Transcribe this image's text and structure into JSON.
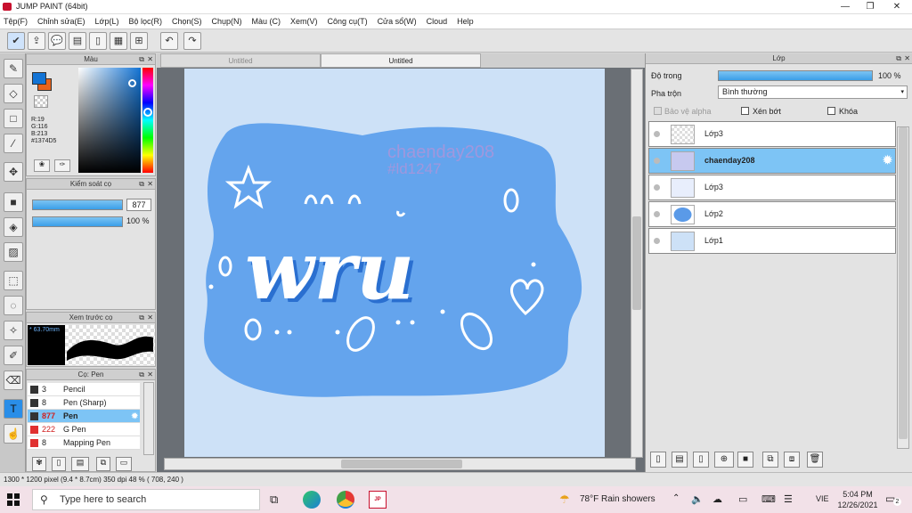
{
  "window": {
    "title": "JUMP PAINT (64bit)",
    "controls": [
      "—",
      "❐",
      "✕"
    ]
  },
  "menu": [
    "Tệp(F)",
    "Chỉnh sửa(E)",
    "Lớp(L)",
    "Bộ lọc(R)",
    "Chọn(S)",
    "Chụp(N)",
    "Màu (C)",
    "Xem(V)",
    "Công cụ(T)",
    "Cửa sổ(W)",
    "Cloud",
    "Help"
  ],
  "color_panel": {
    "title": "Màu",
    "r": "R:19",
    "g": "G:116",
    "b": "B:213",
    "hex": "#1374D5",
    "primary": "#1374d5",
    "secondary": "#e8631c"
  },
  "brush_control": {
    "title": "Kiểm soát cọ",
    "size": "877",
    "opacity": "100 %"
  },
  "preview": {
    "title": "Xem trước cọ",
    "size_label": "* 63.70mm"
  },
  "brush_list": {
    "title": "Cọ: Pen",
    "items": [
      {
        "num": "3",
        "name": "Pencil",
        "color": "#333333"
      },
      {
        "num": "8",
        "name": "Pen (Sharp)",
        "color": "#333333"
      },
      {
        "num": "877",
        "name": "Pen",
        "color": "#333333",
        "selected": true
      },
      {
        "num": "222",
        "name": "G Pen",
        "color": "#e03030"
      },
      {
        "num": "8",
        "name": "Mapping Pen",
        "color": "#e03030"
      }
    ]
  },
  "tabs": [
    "Untitled",
    "Untitled"
  ],
  "canvas": {
    "watermark1": "chaenday208",
    "watermark2": "#ld1247",
    "art_text": "wru"
  },
  "layer_panel": {
    "title": "Lớp",
    "opacity_label": "Độ trong",
    "opacity_value": "100 %",
    "blend_label": "Pha trộn",
    "blend_value": "Bình thường",
    "protect_alpha": "Bảo vệ alpha",
    "clip": "Xén bớt",
    "lock": "Khóa",
    "layers": [
      {
        "name": "Lớp3",
        "selected": false
      },
      {
        "name": "chaenday208",
        "selected": true
      },
      {
        "name": "Lớp3",
        "selected": false
      },
      {
        "name": "Lớp2",
        "selected": false
      },
      {
        "name": "Lớp1",
        "selected": false
      }
    ]
  },
  "status": {
    "text": "1300 * 1200 pixel  (9.4 * 8.7cm)  350 dpi  48 %  ( 708, 240 )"
  },
  "taskbar": {
    "search_placeholder": "Type here to search",
    "weather": "78°F  Rain showers",
    "lang": "VIE",
    "time": "5:04 PM",
    "date": "12/26/2021",
    "notif": "2"
  }
}
